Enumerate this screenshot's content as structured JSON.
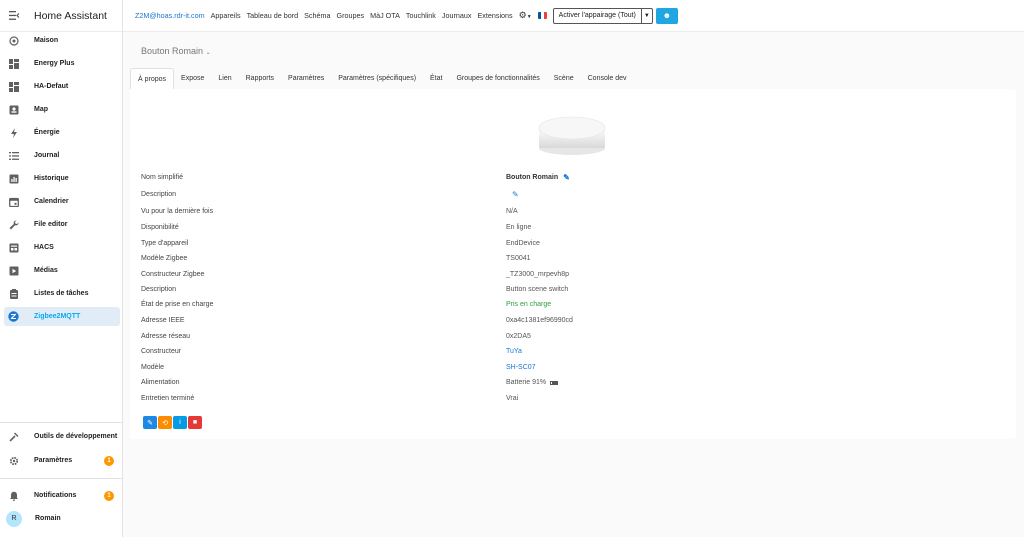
{
  "app": {
    "title": "Home Assistant"
  },
  "sidebar": {
    "items": [
      {
        "label": "Maison",
        "icon": "home-icon"
      },
      {
        "label": "Energy Plus",
        "icon": "dashboard-icon"
      },
      {
        "label": "HA-Defaut",
        "icon": "dashboard-icon"
      },
      {
        "label": "Map",
        "icon": "map-icon"
      },
      {
        "label": "Énergie",
        "icon": "lightning-icon"
      },
      {
        "label": "Journal",
        "icon": "list-icon"
      },
      {
        "label": "Historique",
        "icon": "chart-icon"
      },
      {
        "label": "Calendrier",
        "icon": "calendar-icon"
      },
      {
        "label": "File editor",
        "icon": "wrench-icon"
      },
      {
        "label": "HACS",
        "icon": "hacs-icon"
      },
      {
        "label": "Médias",
        "icon": "media-icon"
      },
      {
        "label": "Listes de tâches",
        "icon": "clipboard-icon"
      },
      {
        "label": "Zigbee2MQTT",
        "icon": "zigbee-icon",
        "active": true
      }
    ],
    "dev_tools": "Outils de développement",
    "settings": "Paramètres",
    "settings_badge": "1",
    "notifications": "Notifications",
    "notifications_badge": "1",
    "user": "Romain",
    "user_initial": "R"
  },
  "topbar": {
    "host": "Z2M@hoas.rdr-it.com",
    "links": [
      "Appareils",
      "Tableau de bord",
      "Schéma",
      "Groupes",
      "MàJ OTA",
      "Touchlink",
      "Journaux",
      "Extensions"
    ],
    "pairing_select": "Activer l'appairage (Tout)"
  },
  "device": {
    "title": "Bouton Romain",
    "tabs": [
      "À propos",
      "Expose",
      "Lien",
      "Rapports",
      "Paramètres",
      "Paramètres (spécifiques)",
      "État",
      "Groupes de fonctionnalités",
      "Scène",
      "Console dev"
    ],
    "active_tab": "À propos",
    "info": [
      {
        "key": "Nom simplifié",
        "value": "Bouton Romain"
      },
      {
        "key": "Description",
        "value": ""
      },
      {
        "key": "Vu pour la dernière fois",
        "value": "N/A"
      },
      {
        "key": "Disponibilité",
        "value": "En ligne"
      },
      {
        "key": "Type d'appareil",
        "value": "EndDevice"
      },
      {
        "key": "Modèle Zigbee",
        "value": "TS0041"
      },
      {
        "key": "Constructeur Zigbee",
        "value": "_TZ3000_mrpevh8p"
      },
      {
        "key": "Description",
        "value": "Button scene switch"
      },
      {
        "key": "État de prise en charge",
        "value": "Pris en charge"
      },
      {
        "key": "Adresse IEEE",
        "value": "0xa4c1381ef96990cd"
      },
      {
        "key": "Adresse réseau",
        "value": "0x2DA5"
      },
      {
        "key": "Constructeur",
        "value": "TuYa"
      },
      {
        "key": "Modèle",
        "value": "SH-SC07"
      },
      {
        "key": "Alimentation",
        "value": "Batterie 91%"
      },
      {
        "key": "Entretien terminé",
        "value": "Vrai"
      }
    ]
  }
}
